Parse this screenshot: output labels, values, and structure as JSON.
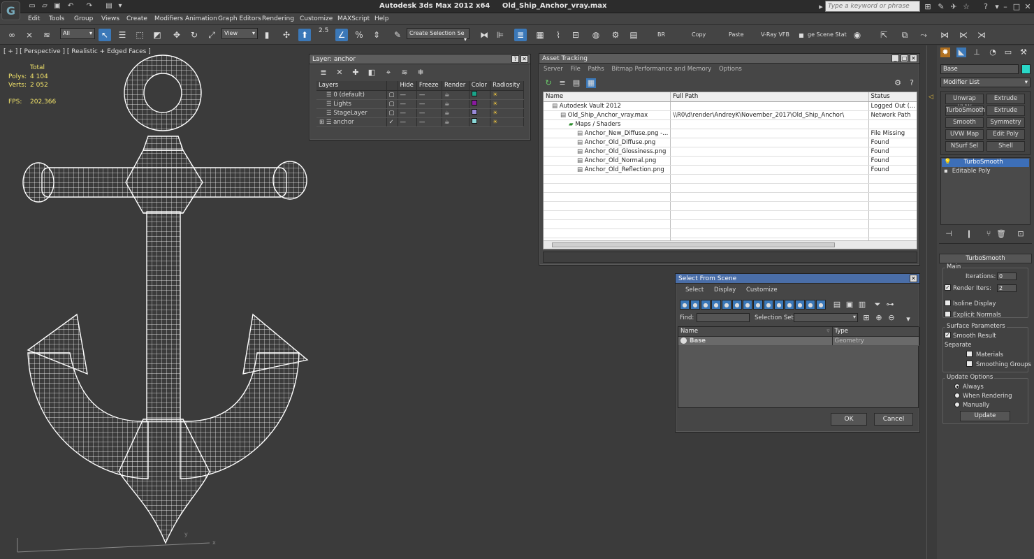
{
  "titlebar": {
    "app_name": "Autodesk 3ds Max  2012 x64",
    "file_name": "Old_Ship_Anchor_vray.max",
    "search_placeholder": "Type a keyword or phrase"
  },
  "menu": [
    "Edit",
    "Tools",
    "Group",
    "Views",
    "Create",
    "Modifiers",
    "Animation",
    "Graph Editors",
    "Rendering",
    "Customize",
    "MAXScript",
    "Help"
  ],
  "toolbar": {
    "selection_filter": "All",
    "ref_coord": "View",
    "snap_value": "2.5",
    "selection_set": "Create Selection Se",
    "br_label": "BR",
    "copy_label": "Copy",
    "paste_label": "Paste",
    "vray_vfb_label": "V-Ray VFB",
    "scene_states_label": "ge Scene Stat"
  },
  "viewport": {
    "label": "[ + ] [ Perspective ] [ Realistic + Edged Faces ]",
    "stats_header": "Total",
    "polys_label": "Polys:",
    "polys_value": "4 104",
    "verts_label": "Verts:",
    "verts_value": "2 052",
    "fps_label": "FPS:",
    "fps_value": "202,366",
    "axis_x": "x",
    "axis_y": "y"
  },
  "layer_dialog": {
    "title": "Layer: anchor",
    "help": "?",
    "columns": [
      "Layers",
      "Hide",
      "Freeze",
      "Render",
      "Color",
      "Radiosity"
    ],
    "rows": [
      {
        "name": "0 (default)",
        "color": "#1aa58a",
        "active": false
      },
      {
        "name": "Lights",
        "color": "#8a1aa0",
        "active": false
      },
      {
        "name": "StageLayer",
        "color": "#9a8ad8",
        "active": false
      },
      {
        "name": "anchor",
        "color": "#8ad8d8",
        "active": true
      }
    ]
  },
  "asset_tracking": {
    "title": "Asset Tracking",
    "menu": [
      "Server",
      "File",
      "Paths",
      "Bitmap Performance and Memory",
      "Options"
    ],
    "columns": [
      "Name",
      "Full Path",
      "Status"
    ],
    "rows": [
      {
        "name": "Autodesk Vault 2012",
        "path": "",
        "status": "Logged Out (...",
        "indent": 1
      },
      {
        "name": "Old_Ship_Anchor_vray.max",
        "path": "\\\\R0\\d\\render\\AndreyK\\November_2017\\Old_Ship_Anchor\\",
        "status": "Network Path",
        "indent": 2
      },
      {
        "name": "Maps / Shaders",
        "path": "",
        "status": "",
        "indent": 3
      },
      {
        "name": "Anchor_New_Diffuse.png -...",
        "path": "",
        "status": "File Missing",
        "indent": 4
      },
      {
        "name": "Anchor_Old_Diffuse.png",
        "path": "",
        "status": "Found",
        "indent": 4
      },
      {
        "name": "Anchor_Old_Glossiness.png",
        "path": "",
        "status": "Found",
        "indent": 4
      },
      {
        "name": "Anchor_Old_Normal.png",
        "path": "",
        "status": "Found",
        "indent": 4
      },
      {
        "name": "Anchor_Old_Reflection.png",
        "path": "",
        "status": "Found",
        "indent": 4
      }
    ]
  },
  "select_from_scene": {
    "title": "Select From Scene",
    "menu": [
      "Select",
      "Display",
      "Customize"
    ],
    "find_label": "Find:",
    "selection_set_label": "Selection Set:",
    "columns": [
      "Name",
      "Type"
    ],
    "rows": [
      {
        "name": "Base",
        "type": "Geometry"
      }
    ],
    "ok_label": "OK",
    "cancel_label": "Cancel"
  },
  "command_panel": {
    "object_name": "Base",
    "object_color": "#2ad8c8",
    "modifier_list": "Modifier List",
    "modifier_buttons": [
      "Unwrap UVW",
      "Extrude",
      "TurboSmooth",
      "Extrude",
      "Smooth",
      "Symmetry",
      "UVW Map",
      "Edit Poly",
      "NSurf Sel",
      "Shell"
    ],
    "stack": [
      "TurboSmooth",
      "Editable Poly"
    ],
    "rollout_title": "TurboSmooth",
    "main_label": "Main",
    "iterations_label": "Iterations:",
    "iterations_value": "0",
    "render_iters_label": "Render Iters:",
    "render_iters_value": "2",
    "isoline_label": "Isoline Display",
    "explicit_normals_label": "Explicit Normals",
    "surface_params_label": "Surface Parameters",
    "smooth_result_label": "Smooth Result",
    "separate_label": "Separate",
    "materials_label": "Materials",
    "smoothing_groups_label": "Smoothing Groups",
    "update_options_label": "Update Options",
    "always_label": "Always",
    "when_rendering_label": "When Rendering",
    "manually_label": "Manually",
    "update_button": "Update"
  }
}
